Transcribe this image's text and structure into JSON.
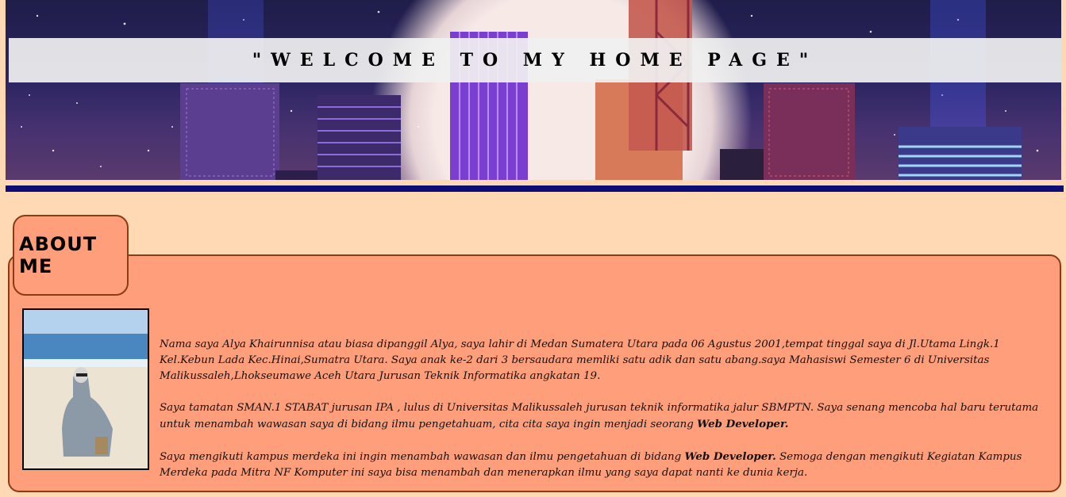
{
  "header": {
    "title": "\"WELCOME TO MY HOME PAGE\""
  },
  "about": {
    "heading": "ABOUT ME",
    "paragraph1": "Nama saya Alya Khairunnisa atau biasa dipanggil Alya, saya lahir di Medan Sumatera Utara pada 06 Agustus 2001,tempat tinggal saya di Jl.Utama Lingk.1 Kel.Kebun Lada Kec.Hinai,Sumatra Utara. Saya anak ke-2 dari 3 bersaudara memliki satu adik dan satu abang.saya Mahasiswi Semester 6 di Universitas Malikussaleh,Lhokseumawe Aceh Utara Jurusan Teknik Informatika angkatan 19.",
    "paragraph2_text": "Saya tamatan SMAN.1 STABAT jurusan IPA , lulus di Universitas Malikussaleh jurusan teknik informatika jalur SBMPTN. Saya senang mencoba hal baru terutama untuk menambah wawasan saya di bidang ilmu pengetahuam, cita cita saya ingin menjadi seorang ",
    "paragraph2_bold": "Web Developer.",
    "paragraph3_text": "Saya mengikuti kampus merdeka ini ingin menambah wawasan dan ilmu pengetahuan di bidang ",
    "paragraph3_bold": "Web Developer.",
    "paragraph3_rest": " Semoga dengan mengikuti Kegiatan Kampus Merdeka pada Mitra NF Komputer ini saya bisa menambah dan menerapkan ilmu yang saya dapat nanti ke dunia kerja."
  },
  "colors": {
    "page_bg": "#ffd9b3",
    "section_bg": "#ff9e7a",
    "border": "#8b3c14",
    "rule": "#0c0c74"
  }
}
